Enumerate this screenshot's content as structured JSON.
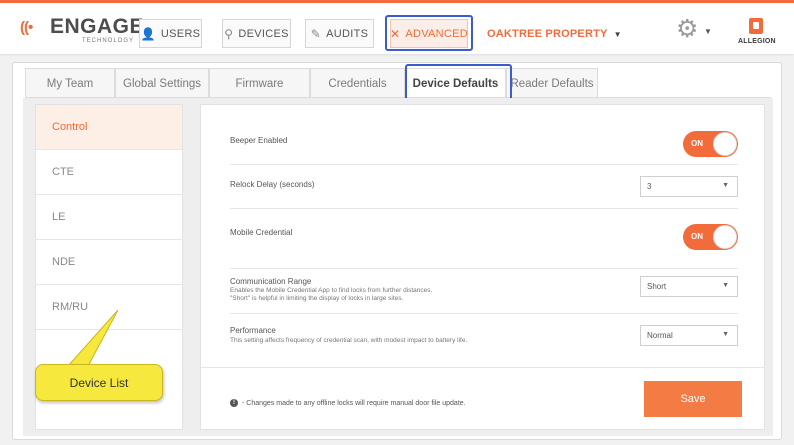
{
  "header": {
    "logo_main": "ENGAGE",
    "logo_sub": "TECHNOLOGY",
    "nav": [
      {
        "label": "USERS",
        "icon": "user-icon"
      },
      {
        "label": "DEVICES",
        "icon": "device-icon"
      },
      {
        "label": "AUDITS",
        "icon": "audits-icon"
      },
      {
        "label": "ADVANCED",
        "icon": "tools-icon",
        "active": true
      }
    ],
    "property_name": "OAKTREE PROPERTY",
    "brand": "ALLEGION"
  },
  "tabs": [
    {
      "label": "My Team"
    },
    {
      "label": "Global Settings"
    },
    {
      "label": "Firmware"
    },
    {
      "label": "Credentials"
    },
    {
      "label": "Device Defaults",
      "active": true
    },
    {
      "label": "Reader Defaults"
    }
  ],
  "sidebar": {
    "items": [
      {
        "label": "Control",
        "active": true
      },
      {
        "label": "CTE"
      },
      {
        "label": "LE"
      },
      {
        "label": "NDE"
      },
      {
        "label": "RM/RU"
      }
    ]
  },
  "settings": {
    "beeper": {
      "label": "Beeper Enabled",
      "toggle_text": "ON",
      "value": true
    },
    "relock": {
      "label": "Relock Delay (seconds)",
      "value": "3"
    },
    "mobile": {
      "label": "Mobile Credential",
      "toggle_text": "ON",
      "value": true
    },
    "range": {
      "label": "Communication Range",
      "desc1": "Enables the Mobile Credential App to find locks from further distances.",
      "desc2": "\"Short\" is helpful in limiting the display of locks in large sites.",
      "value": "Short"
    },
    "performance": {
      "label": "Performance",
      "desc1": "This setting affects frequency of credential scan, with modest impact to battery life.",
      "value": "Normal"
    }
  },
  "footer": {
    "note": "- Changes made to any offline locks will require manual door file update.",
    "save_label": "Save"
  },
  "callout": {
    "text": "Device List"
  },
  "colors": {
    "accent": "#f26b3a",
    "highlight_outline": "#3b5bd1",
    "callout": "#f6e83c"
  }
}
